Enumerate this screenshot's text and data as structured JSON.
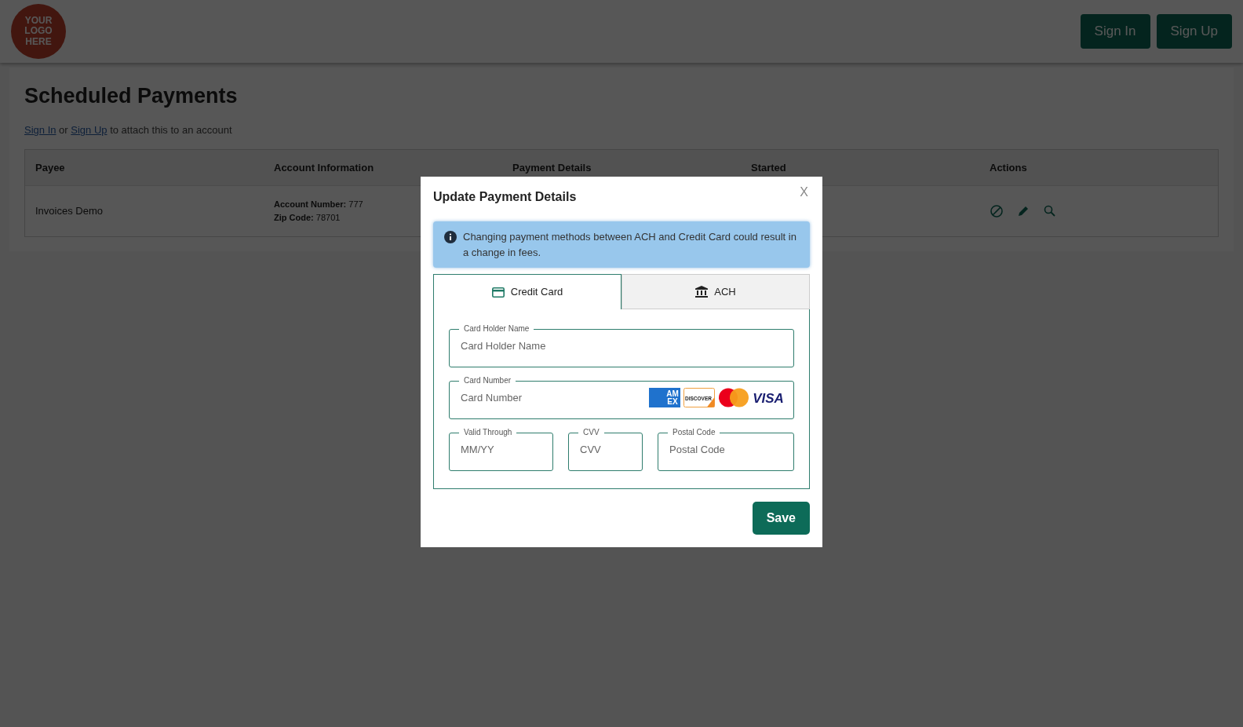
{
  "header": {
    "logo_lines": [
      "YOUR",
      "LOGO",
      "HERE"
    ],
    "buttons": [
      "Sign In",
      "Sign Up"
    ]
  },
  "page": {
    "title": "Scheduled Payments",
    "note": [
      {
        "kind": "link",
        "text": "Sign In"
      },
      {
        "kind": "text",
        "text": " or "
      },
      {
        "kind": "link",
        "text": "Sign Up"
      },
      {
        "kind": "text",
        "text": " to attach this to an account"
      }
    ]
  },
  "table": {
    "columns": [
      "Payee",
      "Account Information",
      "Payment Details",
      "Started",
      "Actions"
    ],
    "rows": [
      {
        "payee": "Invoices Demo",
        "account_lines": [
          "**Account Number:** 777",
          "**Zip Code:** 78701"
        ]
      }
    ]
  },
  "modal": {
    "title": "Update Payment Details",
    "close": "X",
    "alert": "Changing payment methods between ACH and Credit Card could result in a change in fees.",
    "tabs": [
      {
        "label": "Credit Card",
        "kind": "card",
        "selected": true
      },
      {
        "label": "ACH",
        "kind": "bank",
        "selected": false
      }
    ],
    "fields": [
      {
        "label": "Card Holder Name",
        "placeholder": "Card Holder Name"
      },
      {
        "label": "Card Number",
        "placeholder": "Card Number"
      },
      {
        "label": "Valid Through",
        "placeholder": "MM/YY"
      },
      {
        "label": "CVV",
        "placeholder": "CVV"
      },
      {
        "label": "Postal Code",
        "placeholder": "Postal Code"
      }
    ],
    "card_logos": [
      {
        "kind": "amex",
        "lines": [
          "AM",
          "EX"
        ]
      },
      {
        "kind": "discover",
        "lines": [
          "DISCOVER"
        ]
      },
      {
        "kind": "mastercard"
      },
      {
        "kind": "visa",
        "lines": [
          "VISA"
        ]
      }
    ],
    "save": "Save"
  }
}
